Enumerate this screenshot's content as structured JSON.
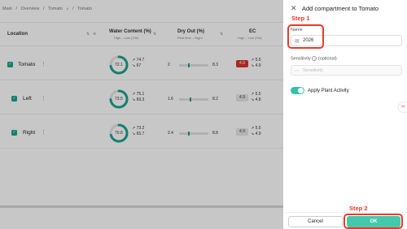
{
  "breadcrumb": [
    "Main",
    "/",
    "Overview",
    "/",
    "Tomato",
    "/",
    "Tomato"
  ],
  "table": {
    "headers": {
      "location": "Location",
      "water": "Water Content (%)",
      "water_sub": "High – Low (24h)",
      "dry": "Dry Out (%)",
      "dry_sub": "Real time – Night",
      "ec": "EC",
      "ec_sub": "High – Low (%d)"
    },
    "rows": [
      {
        "name": "Tomato",
        "water": "72.1",
        "water_fill": 0.72,
        "water_high": "74.7",
        "water_low": "67",
        "dry_min": "2",
        "dry_max": "8.3",
        "dry_mark": 0.3,
        "ec": "4.9",
        "ec_alert": true,
        "ec_high": "5.5",
        "ec_low": "4.9"
      },
      {
        "name": "Left",
        "water": "73.5",
        "water_fill": 0.735,
        "water_high": "75.1",
        "water_low": "69.3",
        "dry_min": "1.6",
        "dry_max": "8.2",
        "dry_mark": 0.35,
        "ec": "4.9",
        "ec_alert": false,
        "ec_high": "5.5",
        "ec_low": "4.8"
      },
      {
        "name": "Right",
        "water": "70.8",
        "water_fill": 0.708,
        "water_high": "73.2",
        "water_low": "65.7",
        "dry_min": "2.4",
        "dry_max": "8.8",
        "dry_mark": 0.3,
        "ec": "4.9",
        "ec_alert": false,
        "ec_high": "5.5",
        "ec_low": "4.9"
      }
    ]
  },
  "panel": {
    "title": "Add compartment to Tomato",
    "step1": "Step 1",
    "name_label": "Name",
    "name_value": "2026",
    "sensitivity_label": "Sensitivity",
    "sensitivity_optional": "(optional)",
    "sensitivity_placeholder": "Sensitivity",
    "apply_label": "Apply Plant Activity",
    "apply_on": true,
    "step2": "Step 2",
    "cancel_label": "Cancel",
    "ok_label": "OK"
  },
  "colors": {
    "accent": "#1aa58c",
    "annotation": "#e8392b",
    "ok_button": "#45c9ad",
    "ec_alert": "#d9342b"
  }
}
